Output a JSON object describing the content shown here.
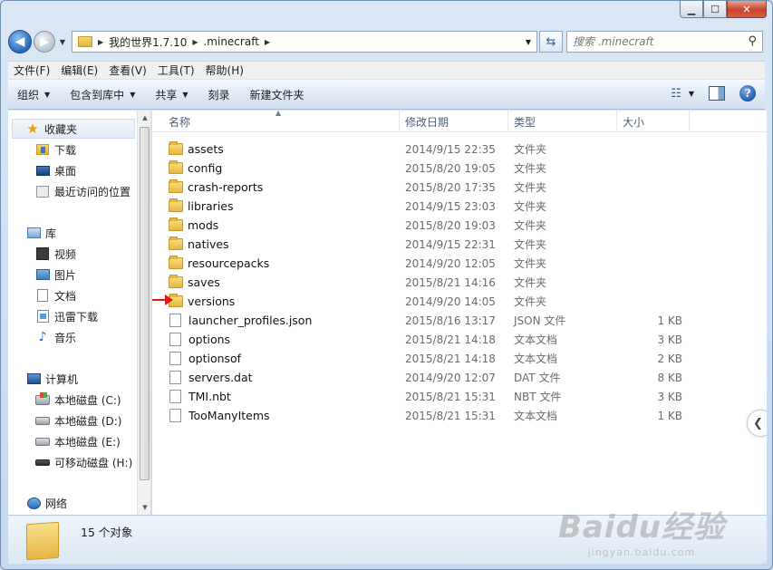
{
  "window": {
    "caption": {
      "minimize": "▁",
      "maximize": "☐",
      "close": "✕"
    }
  },
  "address": {
    "crumbs": [
      "我的世界1.7.10",
      ".minecraft"
    ],
    "search_placeholder": "搜索 .minecraft"
  },
  "menubar": {
    "items": [
      "文件(F)",
      "编辑(E)",
      "查看(V)",
      "工具(T)",
      "帮助(H)"
    ]
  },
  "commandbar": {
    "items": [
      "组织",
      "包含到库中",
      "共享",
      "刻录",
      "新建文件夹"
    ]
  },
  "navpane": {
    "favorites": {
      "label": "收藏夹",
      "items": [
        "下载",
        "桌面",
        "最近访问的位置"
      ]
    },
    "libraries": {
      "label": "库",
      "items": [
        "视频",
        "图片",
        "文档",
        "迅雷下载",
        "音乐"
      ]
    },
    "computer": {
      "label": "计算机",
      "items": [
        "本地磁盘 (C:)",
        "本地磁盘 (D:)",
        "本地磁盘 (E:)",
        "可移动磁盘 (H:)"
      ]
    },
    "network": {
      "label": "网络"
    }
  },
  "columns": {
    "name": "名称",
    "date": "修改日期",
    "type": "类型",
    "size": "大小"
  },
  "files": [
    {
      "name": "assets",
      "date": "2014/9/15 22:35",
      "type": "文件夹",
      "size": "",
      "kind": "folder"
    },
    {
      "name": "config",
      "date": "2015/8/20 19:05",
      "type": "文件夹",
      "size": "",
      "kind": "folder"
    },
    {
      "name": "crash-reports",
      "date": "2015/8/20 17:35",
      "type": "文件夹",
      "size": "",
      "kind": "folder"
    },
    {
      "name": "libraries",
      "date": "2014/9/15 23:03",
      "type": "文件夹",
      "size": "",
      "kind": "folder"
    },
    {
      "name": "mods",
      "date": "2015/8/20 19:03",
      "type": "文件夹",
      "size": "",
      "kind": "folder"
    },
    {
      "name": "natives",
      "date": "2014/9/15 22:31",
      "type": "文件夹",
      "size": "",
      "kind": "folder"
    },
    {
      "name": "resourcepacks",
      "date": "2014/9/20 12:05",
      "type": "文件夹",
      "size": "",
      "kind": "folder"
    },
    {
      "name": "saves",
      "date": "2015/8/21 14:16",
      "type": "文件夹",
      "size": "",
      "kind": "folder"
    },
    {
      "name": "versions",
      "date": "2014/9/20 14:05",
      "type": "文件夹",
      "size": "",
      "kind": "folder"
    },
    {
      "name": "launcher_profiles.json",
      "date": "2015/8/16 13:17",
      "type": "JSON 文件",
      "size": "1 KB",
      "kind": "file"
    },
    {
      "name": "options",
      "date": "2015/8/21 14:18",
      "type": "文本文档",
      "size": "3 KB",
      "kind": "file"
    },
    {
      "name": "optionsof",
      "date": "2015/8/21 14:18",
      "type": "文本文档",
      "size": "2 KB",
      "kind": "file"
    },
    {
      "name": "servers.dat",
      "date": "2014/9/20 12:07",
      "type": "DAT 文件",
      "size": "8 KB",
      "kind": "file"
    },
    {
      "name": "TMI.nbt",
      "date": "2015/8/21 15:31",
      "type": "NBT 文件",
      "size": "3 KB",
      "kind": "file"
    },
    {
      "name": "TooManyItems",
      "date": "2015/8/21 15:31",
      "type": "文本文档",
      "size": "1 KB",
      "kind": "file"
    }
  ],
  "details": {
    "count": "15 个对象"
  },
  "watermark": {
    "main": "Baidu经验",
    "sub": "jingyan.baidu.com"
  },
  "colors": {
    "accent": "#2668b8",
    "arrow": "#e21616"
  }
}
